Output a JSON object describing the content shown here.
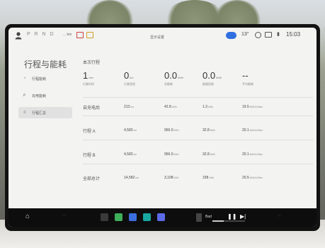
{
  "status_bar": {
    "gear": "P R N D",
    "range": "... km",
    "center_title": "显示设置",
    "temperature": "13°",
    "time": "15:03"
  },
  "sidebar": {
    "title": "行程与能耗",
    "items": [
      {
        "label": "行程能耗",
        "icon": "clock-icon",
        "active": false
      },
      {
        "label": "充电能耗",
        "icon": "plug-icon",
        "active": false
      },
      {
        "label": "行程汇总",
        "icon": "chart-icon",
        "active": true
      }
    ]
  },
  "main": {
    "section_title": "本次行程",
    "stats": [
      {
        "value": "1",
        "unit": "min",
        "label": "行驶时间"
      },
      {
        "value": "0",
        "unit": "km",
        "label": "行驶里程"
      },
      {
        "value": "0.0",
        "unit": "kWh",
        "label": "总能耗"
      },
      {
        "value": "0.0",
        "unit": "kWh",
        "label": "能量回收"
      },
      {
        "value": "--",
        "unit": "",
        "label": "平均能耗"
      }
    ],
    "rows": [
      {
        "label": "自充电后",
        "distance": "213",
        "energy": "42.8",
        "recovered": "1.3",
        "average": "19.5"
      },
      {
        "label": "行程 A",
        "distance": "4,582",
        "energy": "956.0",
        "recovered": "32.8",
        "average": "20.1"
      },
      {
        "label": "行程 B",
        "distance": "4,582",
        "energy": "956.0",
        "recovered": "32.8",
        "average": "20.1"
      },
      {
        "label": "全部总计",
        "distance": "14,582",
        "energy": "3,108",
        "recovered": "158",
        "average": "20.5"
      }
    ],
    "units": {
      "distance": "km",
      "energy": "kWh",
      "recovered": "kWh",
      "average": "kWh/100km"
    }
  },
  "taskbar": {
    "media_title": "Bad",
    "media_progress": 0.35,
    "app_colors": [
      "#3a3a3a",
      "#3fae5a",
      "#3b6fe0",
      "#18a6a0",
      "#5d6ae8"
    ]
  }
}
